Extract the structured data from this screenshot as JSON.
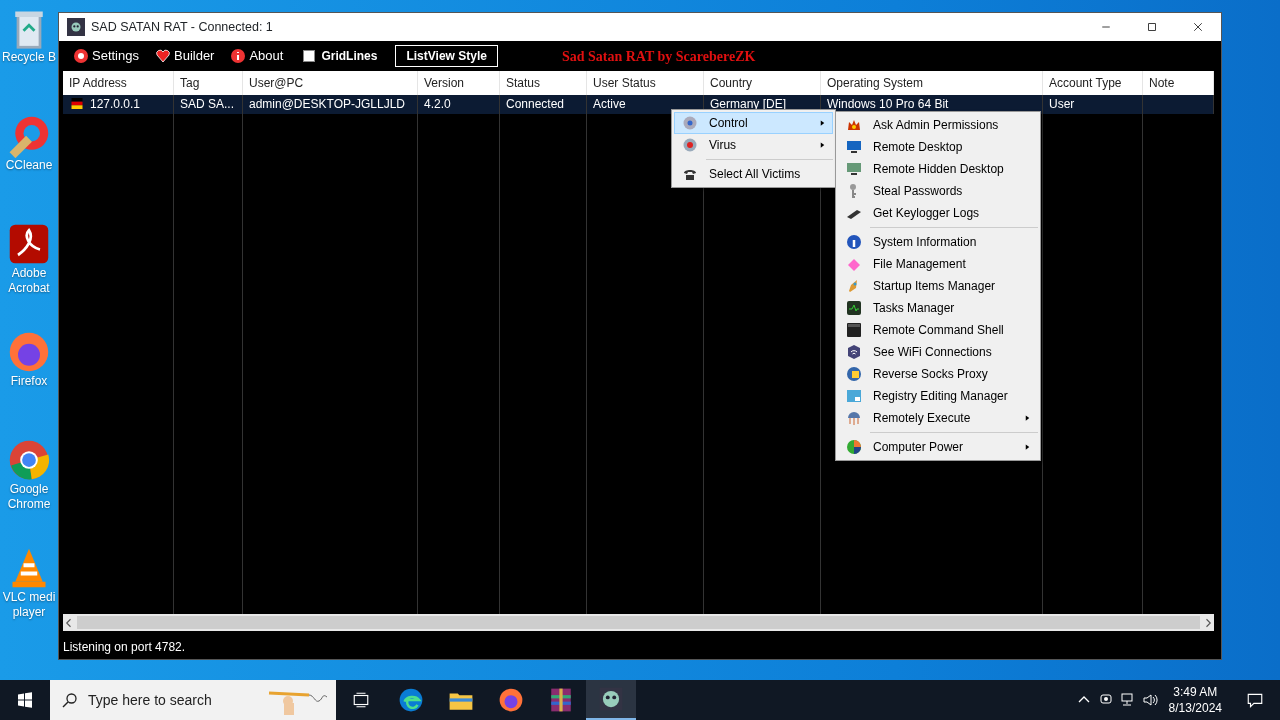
{
  "desktop_icons": [
    {
      "label": "Recycle B"
    },
    {
      "label": "CCleane"
    },
    {
      "label": "Adobe Acrobat"
    },
    {
      "label": "Firefox"
    },
    {
      "label": "Google Chrome"
    },
    {
      "label": "VLC medi player"
    }
  ],
  "window": {
    "title": "SAD SATAN RAT - Connected: 1"
  },
  "toolbar": {
    "items": [
      {
        "label": "Settings"
      },
      {
        "label": "Builder"
      },
      {
        "label": "About"
      }
    ],
    "gridlines": {
      "label": "GridLines",
      "checked": false
    },
    "style_button": "ListView Style",
    "banner": "Sad Satan RAT by ScarebereZK"
  },
  "table": {
    "columns": [
      "IP Address",
      "Tag",
      "User@PC",
      "Version",
      "Status",
      "User Status",
      "Country",
      "Operating System",
      "Account Type",
      "Note"
    ],
    "rows": [
      {
        "selected": true,
        "cells": [
          "127.0.0.1",
          "SAD SA...",
          "admin@DESKTOP-JGLLJLD",
          "4.2.0",
          "Connected",
          "Active",
          "Germany [DE]",
          "Windows 10 Pro 64 Bit",
          "User"
        ]
      }
    ]
  },
  "context_menu": {
    "items": [
      {
        "kind": "item",
        "label": "Control",
        "submenu": true,
        "selected": true
      },
      {
        "kind": "item",
        "label": "Virus",
        "submenu": true,
        "selected": false
      },
      {
        "kind": "separator"
      },
      {
        "kind": "item",
        "label": "Select All Victims",
        "submenu": false,
        "selected": false
      }
    ]
  },
  "submenu": {
    "items": [
      {
        "kind": "item",
        "label": "Ask Admin Permissions",
        "submenu": false
      },
      {
        "kind": "item",
        "label": "Remote Desktop",
        "submenu": false
      },
      {
        "kind": "item",
        "label": "Remote Hidden Desktop",
        "submenu": false
      },
      {
        "kind": "item",
        "label": "Steal Passwords",
        "submenu": false
      },
      {
        "kind": "item",
        "label": "Get Keylogger Logs",
        "submenu": false
      },
      {
        "kind": "separator"
      },
      {
        "kind": "item",
        "label": "System Information",
        "submenu": false
      },
      {
        "kind": "item",
        "label": "File Management",
        "submenu": false
      },
      {
        "kind": "item",
        "label": "Startup Items Manager",
        "submenu": false
      },
      {
        "kind": "item",
        "label": "Tasks Manager",
        "submenu": false
      },
      {
        "kind": "item",
        "label": "Remote Command Shell",
        "submenu": false
      },
      {
        "kind": "item",
        "label": "See WiFi Connections",
        "submenu": false
      },
      {
        "kind": "item",
        "label": "Reverse Socks Proxy",
        "submenu": false
      },
      {
        "kind": "item",
        "label": "Registry Editing Manager",
        "submenu": false
      },
      {
        "kind": "item",
        "label": "Remotely Execute",
        "submenu": true
      },
      {
        "kind": "separator"
      },
      {
        "kind": "item",
        "label": "Computer Power",
        "submenu": true
      }
    ]
  },
  "status_bar": "Listening on port 4782.",
  "taskbar": {
    "search": {
      "placeholder": "Type here to search"
    },
    "time": "3:49 AM",
    "date": "8/13/2024"
  }
}
